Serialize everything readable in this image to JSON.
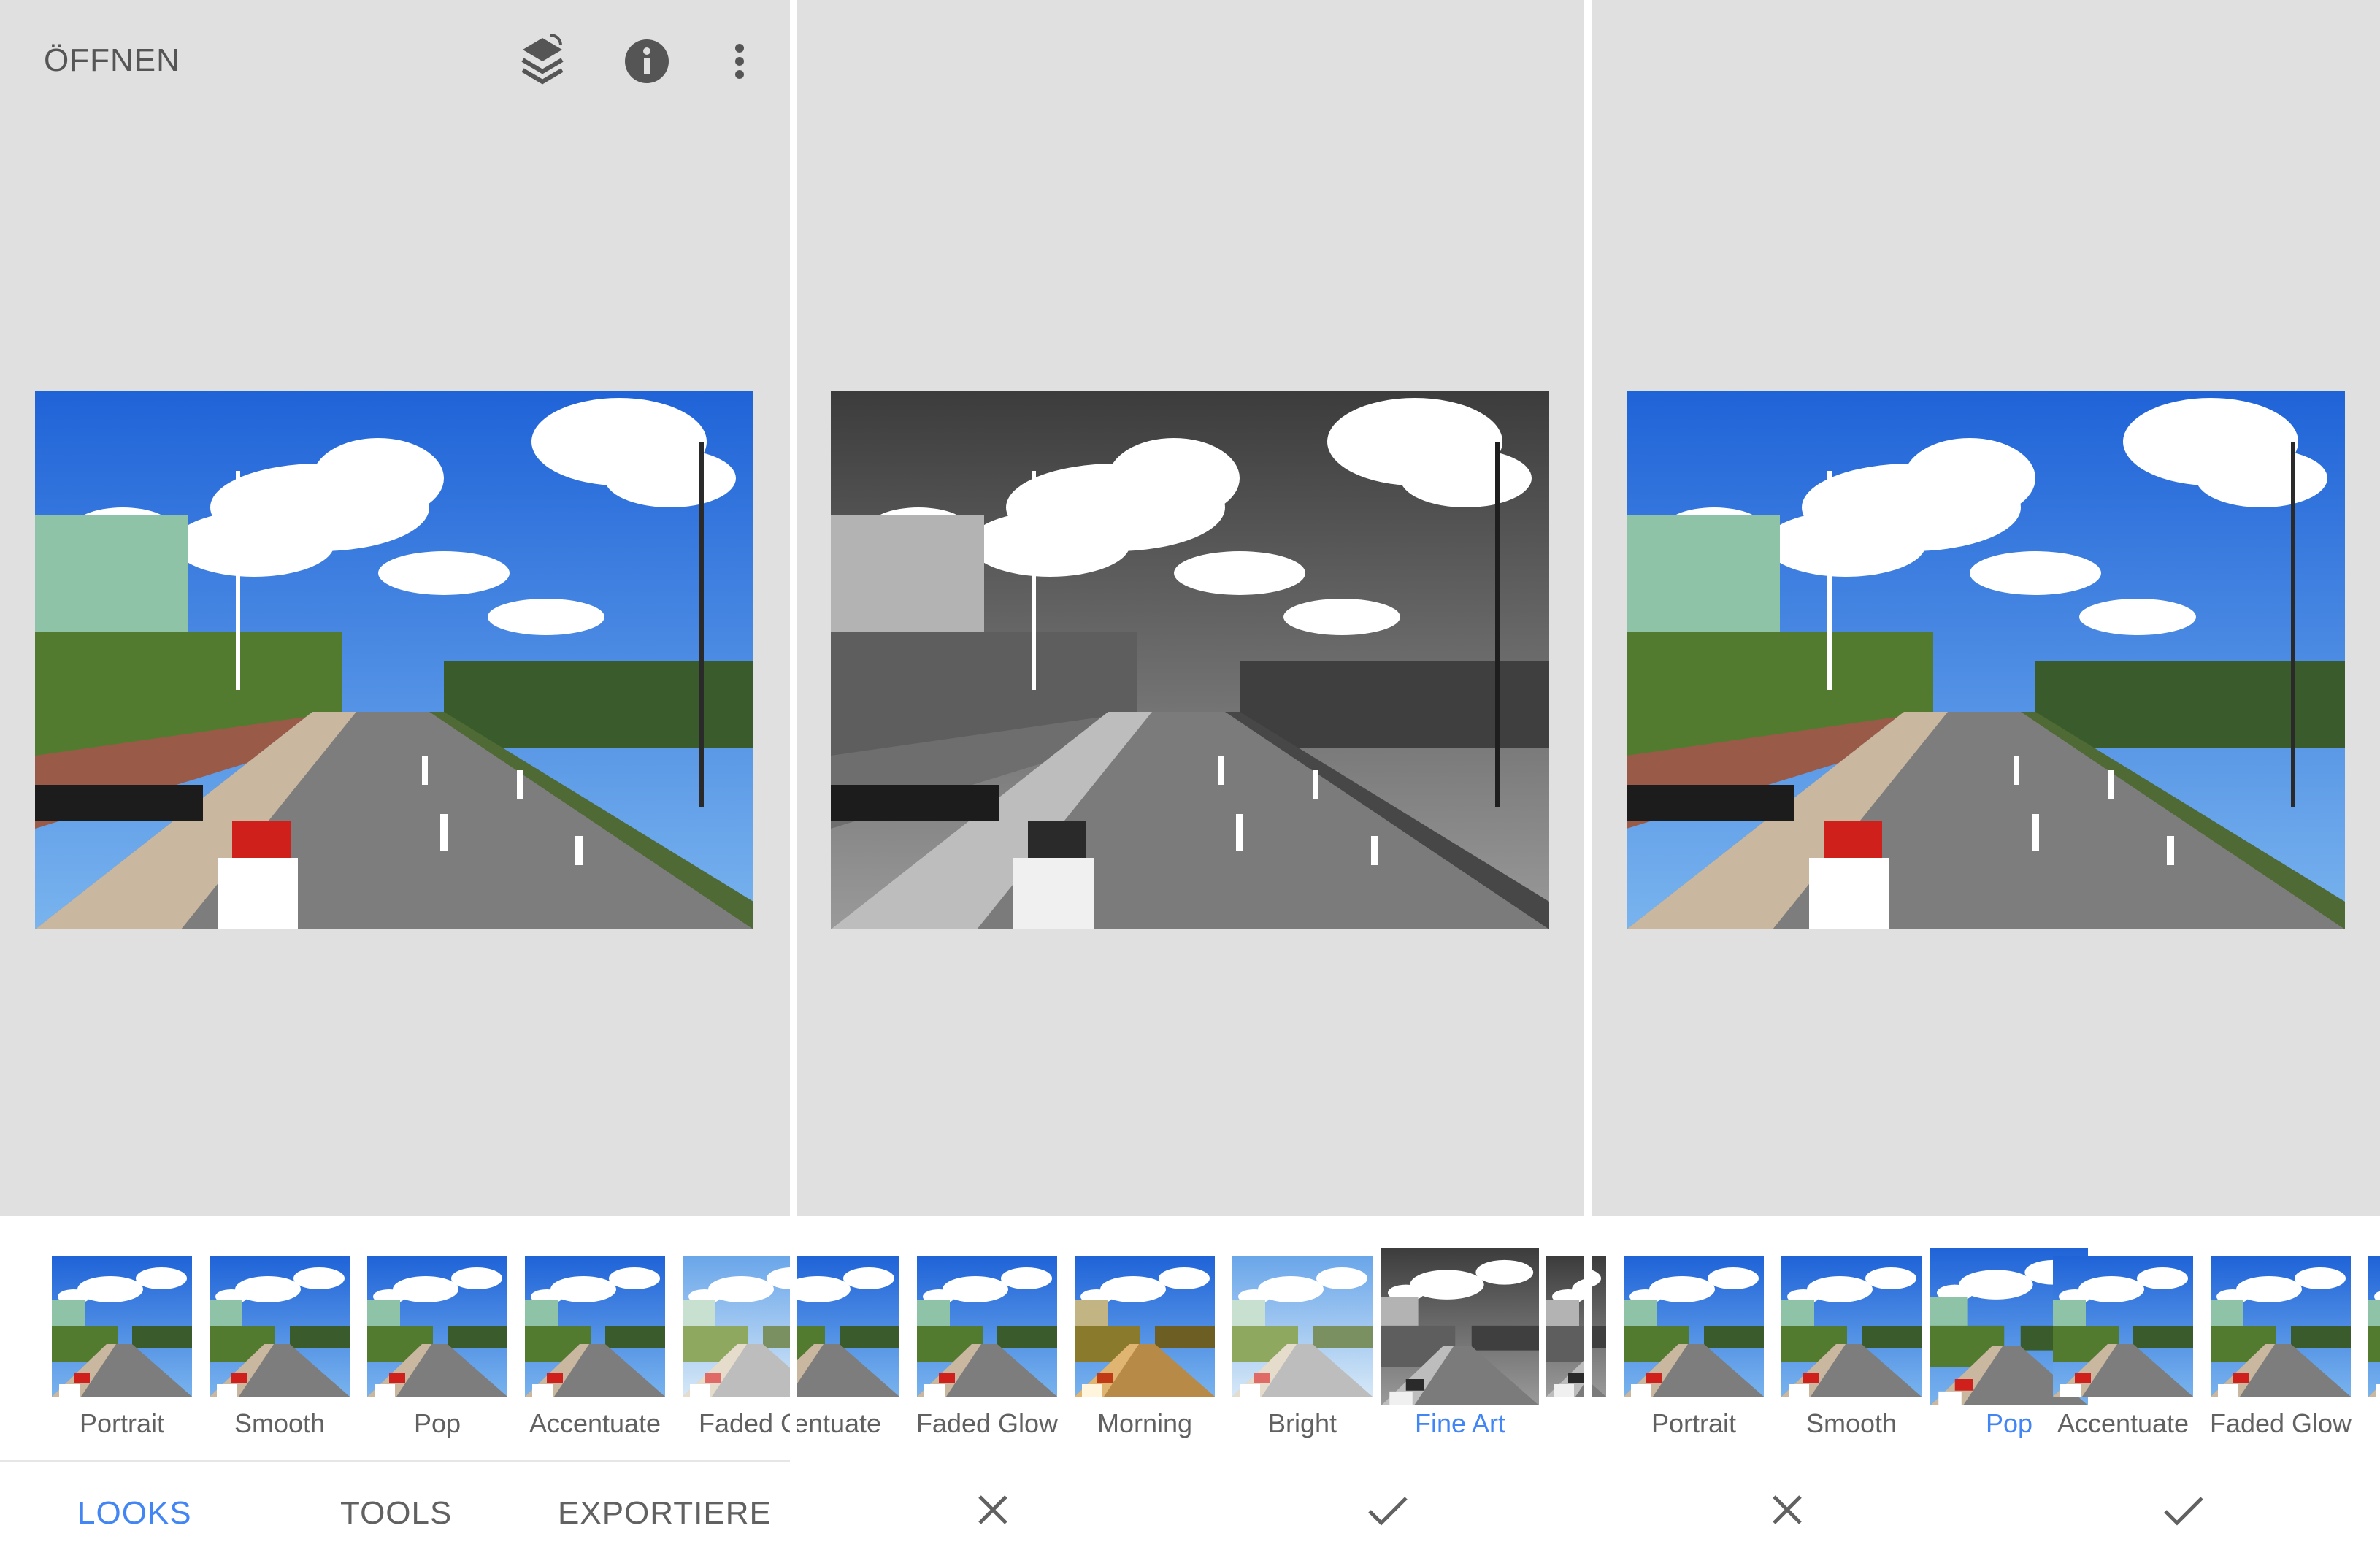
{
  "colors": {
    "accent": "#4285f4",
    "text": "#616161",
    "canvas": "#e0e0e0"
  },
  "panel1": {
    "title": "ÖFFNEN",
    "toolbar_icons": [
      "layers-stack-icon",
      "info-icon",
      "more-vert-icon"
    ],
    "looks": [
      "Portrait",
      "Smooth",
      "Pop",
      "Accentuate",
      "Faded Gl"
    ],
    "tabs": [
      {
        "label": "LOOKS",
        "active": true
      },
      {
        "label": "TOOLS",
        "active": false
      },
      {
        "label": "EXPORTIERE",
        "active": false
      }
    ]
  },
  "panel2": {
    "looks": [
      "centuate",
      "Faded Glow",
      "Morning",
      "Bright",
      "Fine Art"
    ],
    "selected": "Fine Art",
    "actions": [
      "close-icon",
      "check-icon"
    ]
  },
  "panel3": {
    "looks": [
      "Portrait",
      "Smooth",
      "Pop",
      "Accentuate",
      "Faded Glow"
    ],
    "selected": "Pop",
    "actions": [
      "close-icon",
      "check-icon"
    ]
  }
}
